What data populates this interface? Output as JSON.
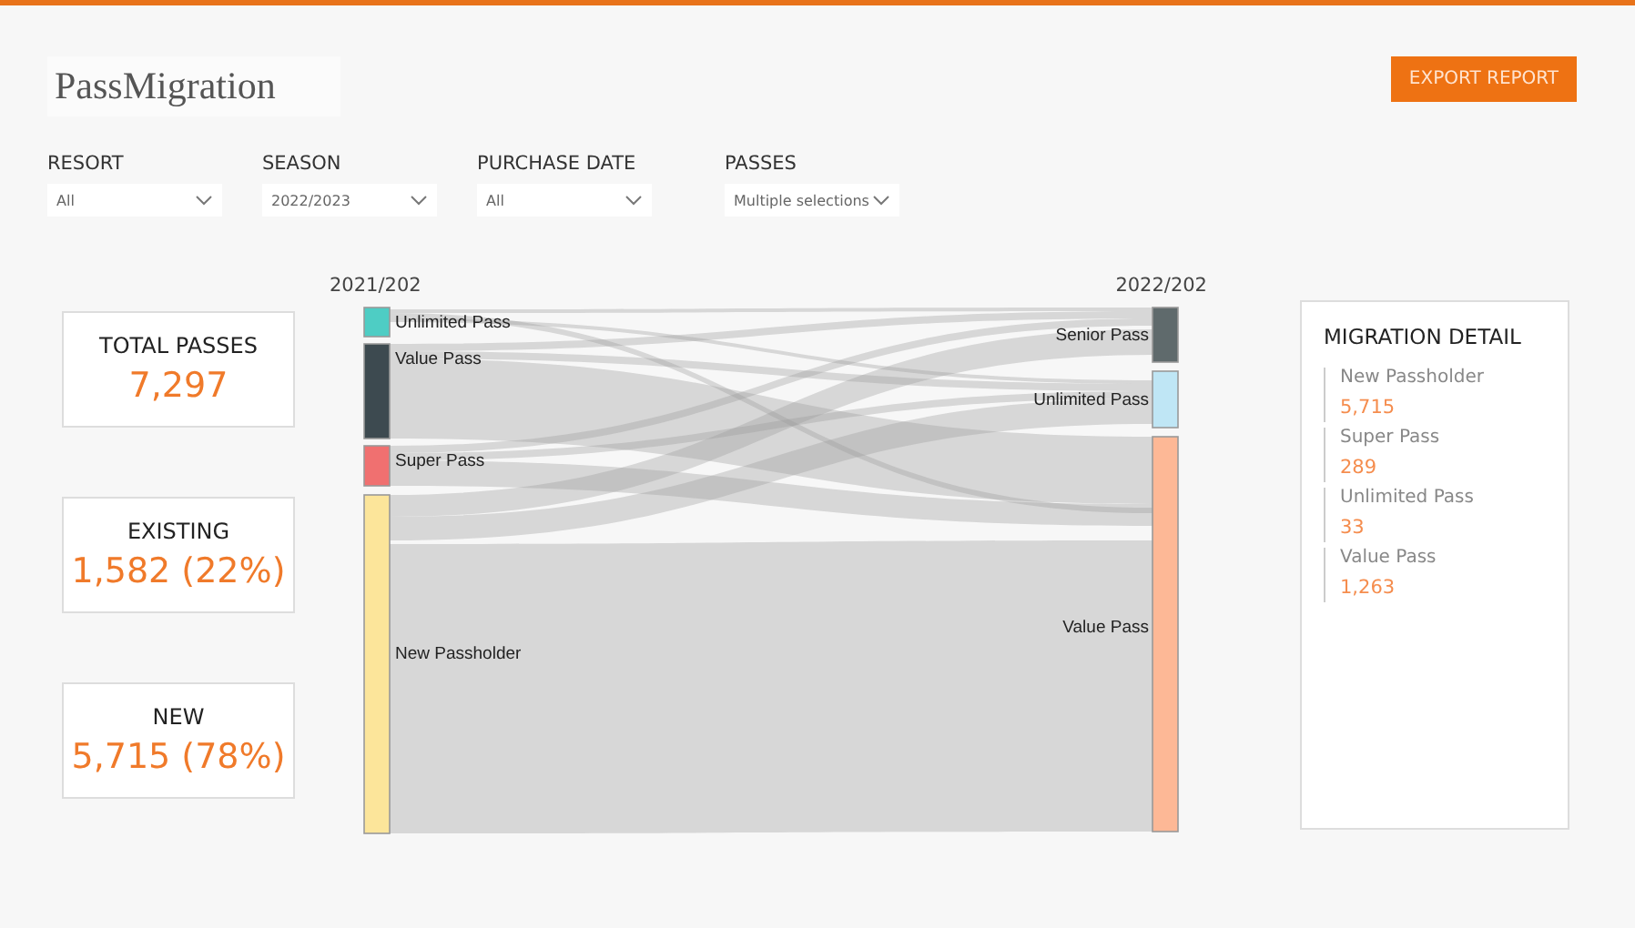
{
  "title": "PassMigration",
  "export_button": "EXPORT REPORT",
  "filters": [
    {
      "label": "RESORT",
      "value": "All"
    },
    {
      "label": "SEASON",
      "value": "2022/2023"
    },
    {
      "label": "PURCHASE DATE",
      "value": "All"
    },
    {
      "label": "PASSES",
      "value": "Multiple selections"
    }
  ],
  "cards": [
    {
      "label": "TOTAL PASSES",
      "value": "7,297"
    },
    {
      "label": "EXISTING",
      "value": "1,582 (22%)"
    },
    {
      "label": "NEW",
      "value": "5,715 (78%)"
    }
  ],
  "sankey": {
    "left_title": "2021/202",
    "right_title": "2022/202",
    "left_nodes": [
      {
        "label": "Unlimited Pass",
        "color": "#4ecdc4"
      },
      {
        "label": "Value Pass",
        "color": "#3d4a50"
      },
      {
        "label": "Super Pass",
        "color": "#f07070"
      },
      {
        "label": "New Passholder",
        "color": "#fce59a"
      }
    ],
    "right_nodes": [
      {
        "label": "Senior Pass",
        "color": "#5f6a6c"
      },
      {
        "label": "Unlimited Pass",
        "color": "#bfe6f5"
      },
      {
        "label": "Value Pass",
        "color": "#fdb896"
      }
    ]
  },
  "migration_detail": {
    "title": "MIGRATION DETAIL",
    "items": [
      {
        "label": "New Passholder",
        "value": "5,715"
      },
      {
        "label": "Super Pass",
        "value": "289"
      },
      {
        "label": "Unlimited Pass",
        "value": "33"
      },
      {
        "label": "Value Pass",
        "value": "1,263"
      }
    ]
  }
}
